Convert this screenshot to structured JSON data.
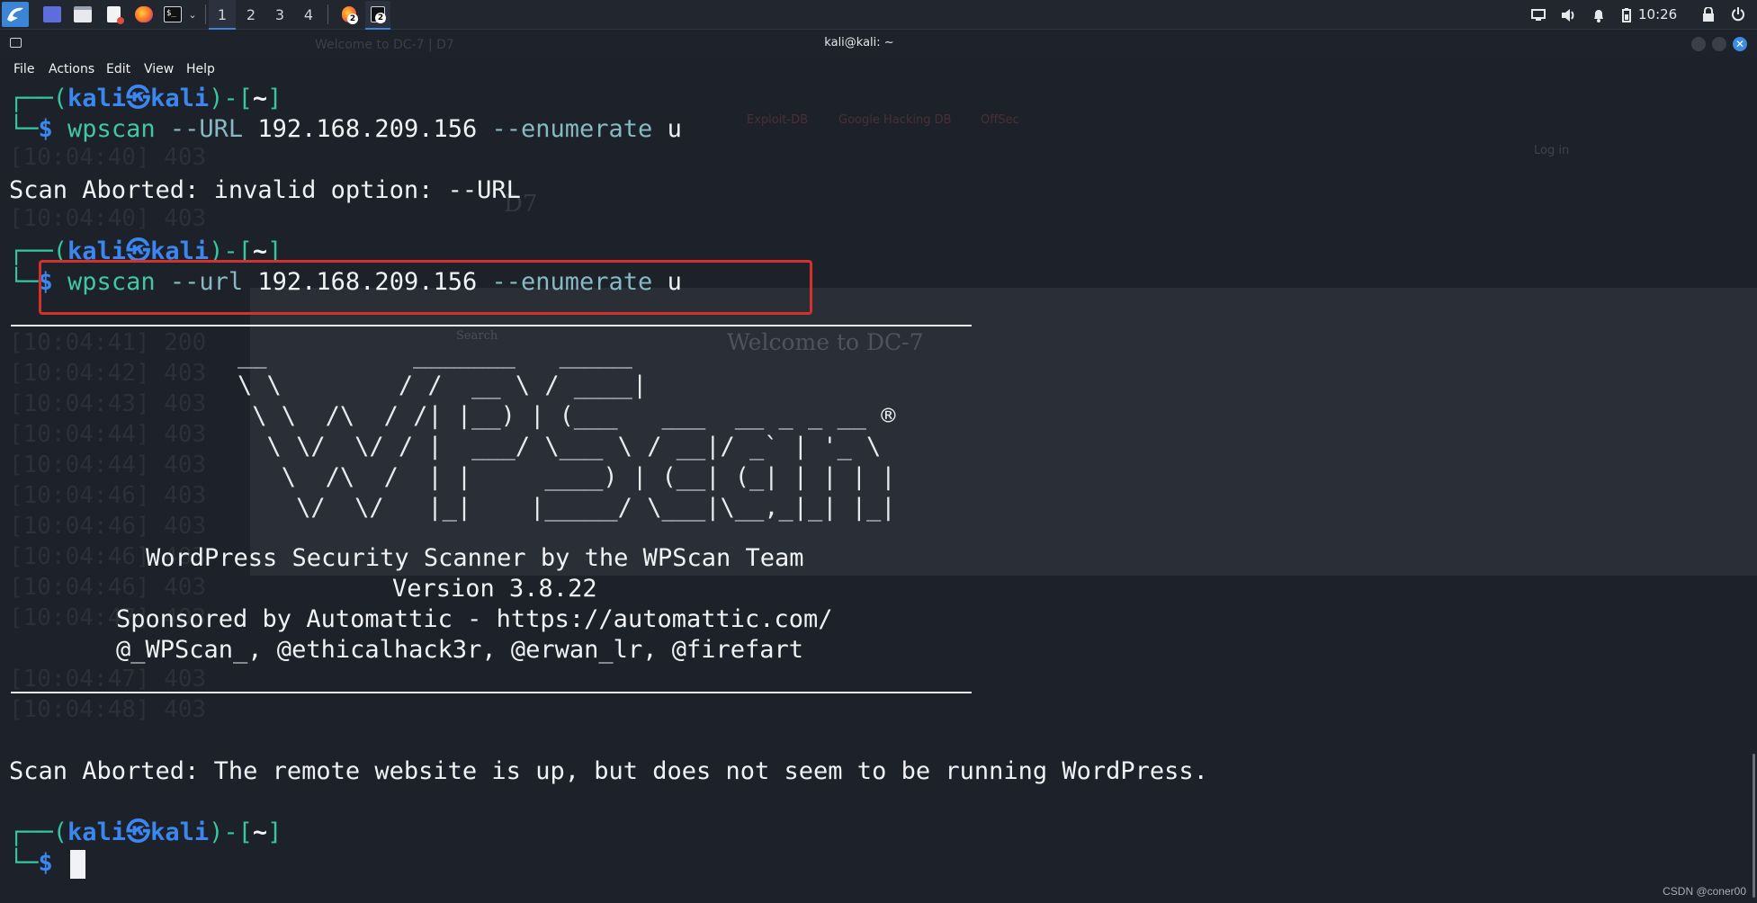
{
  "taskbar": {
    "workspaces": [
      "1",
      "2",
      "3",
      "4"
    ],
    "badges": [
      "2",
      "2"
    ],
    "time": "10:26"
  },
  "window": {
    "title": "kali@kali: ~",
    "close_glyph": "✕"
  },
  "menu": [
    "File",
    "Actions",
    "Edit",
    "View",
    "Help"
  ],
  "terminal": {
    "prompt": {
      "corner_top": "┌──(",
      "user": "kali",
      "skull": "㉿",
      "host": "kali",
      "mid": ")-[",
      "dir": "~",
      "end": "]",
      "corner_bottom": "└─",
      "dollar": "$"
    },
    "cmd1": {
      "bin": "wpscan",
      "flag1": " --URL ",
      "ip": "192.168.209.156",
      "flag2": " --enumerate ",
      "arg": "u"
    },
    "err1": "Scan Aborted: invalid option: --URL",
    "cmd2": {
      "bin": "wpscan",
      "flag1": " --url ",
      "ip": "192.168.209.156",
      "flag2": " --enumerate ",
      "arg": "u"
    },
    "banner_art": "        __          _______   _____\n        \\ \\        / /  __ \\ / ____|\n         \\ \\  /\\  / /| |__) | (___   ___  __ _ _ __ ®\n          \\ \\/  \\/ / |  ___/ \\___ \\ / __|/ _` | '_ \\\n           \\  /\\  /  | |     ____) | (__| (_| | | | |\n            \\/  \\/   |_|    |_____/ \\___|\\__,_|_| |_|",
    "banner_lines": [
      "WordPress Security Scanner by the WPScan Team",
      "Version 3.8.22",
      "Sponsored by Automattic - https://automattic.com/",
      "@_WPScan_, @ethicalhack3r, @erwan_lr, @firefart"
    ],
    "err2": "Scan Aborted: The remote website is up, but does not seem to be running WordPress."
  },
  "ghost_browser": {
    "heading": "Welcome to DC-7",
    "search": "Search",
    "login": "Log in",
    "tab": "Welcome to DC-7 | D7",
    "bookmarks": [
      "Exploit-DB",
      "Google Hacking DB",
      "OffSec"
    ],
    "logo": "D7"
  },
  "ghost_log": [
    "[10:04:40] 403",
    "[10:04:40] 403",
    "[10:04:41] 200",
    "[10:04:42] 403",
    "[10:04:43] 403",
    "[10:04:44] 403",
    "[10:04:44] 403",
    "[10:04:46] 403",
    "[10:04:46] 403",
    "[10:04:46] 403",
    "[10:04:46] 403",
    "[10:04:47] 403",
    "[10:04:47] 403",
    "[10:04:48] 403"
  ],
  "watermark": "CSDN @coner00",
  "colors": {
    "prompt_blue": "#3c86f0",
    "prompt_green": "#34c7a0",
    "highlight_red": "#d3312c",
    "bg": "#1d2129"
  }
}
